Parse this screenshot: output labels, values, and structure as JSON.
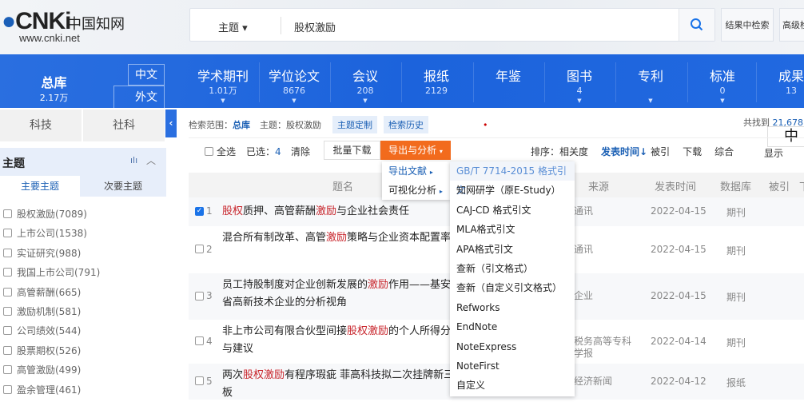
{
  "header": {
    "logo_text": "CNKi",
    "logo_cn": "中国知网",
    "logo_url": "www.cnki.net",
    "search_field": "主题",
    "search_query": "股权激励",
    "btn_in_results": "结果中检索",
    "btn_advanced": "高级检"
  },
  "nav": {
    "zongku": {
      "label": "总库",
      "count": "2.17万"
    },
    "lang_tabs": [
      "中文",
      "外文"
    ],
    "items": [
      {
        "label": "学术期刊",
        "count": "1.01万"
      },
      {
        "label": "学位论文",
        "count": "8676"
      },
      {
        "label": "会议",
        "count": "208"
      },
      {
        "label": "报纸",
        "count": "2129"
      },
      {
        "label": "年鉴",
        "count": ""
      },
      {
        "label": "图书",
        "count": "4"
      },
      {
        "label": "专利",
        "count": ""
      },
      {
        "label": "标准",
        "count": "0"
      },
      {
        "label": "成果",
        "count": "13"
      }
    ]
  },
  "sidebar": {
    "tabs": [
      "科技",
      "社科"
    ],
    "section_title": "主题",
    "subtabs": [
      "主要主题",
      "次要主题"
    ],
    "items": [
      "股权激励(7089)",
      "上市公司(1538)",
      "实证研究(988)",
      "我国上市公司(791)",
      "高管薪酬(665)",
      "激励机制(581)",
      "公司绩效(544)",
      "股票期权(526)",
      "高管激励(499)",
      "盈余管理(461)"
    ]
  },
  "scope": {
    "label": "检索范围：",
    "value": "总库",
    "topic_label": "主题：股权激励",
    "btn_custom": "主题定制",
    "btn_history": "检索历史",
    "found_label": "共找到",
    "found_count": "21,678"
  },
  "toolbar": {
    "select_all": "全选",
    "selected_label": "已选：",
    "selected_count": "4",
    "clear": "清除",
    "batch_download": "批量下载",
    "export_analysis": "导出与分析",
    "sort_label": "排序：",
    "sort_options": [
      "相关度",
      "发表时间↓",
      "被引",
      "下载",
      "综合"
    ],
    "display_label": "显示",
    "ime": "中"
  },
  "export_menu": {
    "items": [
      "导出文献",
      "可视化分析"
    ],
    "formats": [
      "GB/T 7714-2015 格式引文",
      "知网研学（原E-Study）",
      "CAJ-CD 格式引文",
      "MLA格式引文",
      "APA格式引文",
      "查新（引文格式）",
      "查新（自定义引文格式）",
      "Refworks",
      "EndNote",
      "NoteExpress",
      "NoteFirst",
      "自定义"
    ]
  },
  "table": {
    "headers": [
      "题名",
      "来源",
      "发表时间",
      "数据库",
      "被引",
      "下"
    ],
    "rows": [
      {
        "num": "1",
        "checked": true,
        "title": [
          [
            "股权",
            "h"
          ],
          [
            "质押、高管薪酬",
            ""
          ],
          [
            "激励",
            "h"
          ],
          [
            "与企业社会责任",
            ""
          ]
        ],
        "source": "通讯",
        "date": "2022-04-15",
        "db": "期刊"
      },
      {
        "num": "2",
        "checked": false,
        "title": [
          [
            "混合所有制改革、高管",
            ""
          ],
          [
            "激励",
            "h"
          ],
          [
            "策略与企业资本配置率",
            ""
          ]
        ],
        "source": "通讯",
        "date": "2022-04-15",
        "db": "期刊"
      },
      {
        "num": "3",
        "checked": false,
        "title": [
          [
            "员工持股制度对企业创新发展的",
            ""
          ],
          [
            "激励",
            "h"
          ],
          [
            "作用——基安徽省高新技术企业的分析视角",
            ""
          ]
        ],
        "source": "企业",
        "date": "2022-04-15",
        "db": "期刊"
      },
      {
        "num": "4",
        "checked": false,
        "title": [
          [
            "非上市公司有限合伙型间接",
            ""
          ],
          [
            "股权激励",
            "h"
          ],
          [
            "的个人所得分析与建议",
            ""
          ]
        ],
        "source": "税务高等专科学报",
        "date": "2022-04-14",
        "db": "期刊"
      },
      {
        "num": "5",
        "checked": false,
        "title": [
          [
            "两次",
            ""
          ],
          [
            "股权激励",
            "h"
          ],
          [
            "有程序瑕疵 菲高科技拟二次挂牌新三板",
            ""
          ]
        ],
        "source": "经济新闻",
        "date": "2022-04-12",
        "db": "报纸"
      }
    ]
  },
  "colors": {
    "nav_blue": "#1c63dc",
    "accent_orange": "#f26b1d",
    "highlight_red": "#c8252c",
    "link_blue": "#1a5fb4"
  }
}
